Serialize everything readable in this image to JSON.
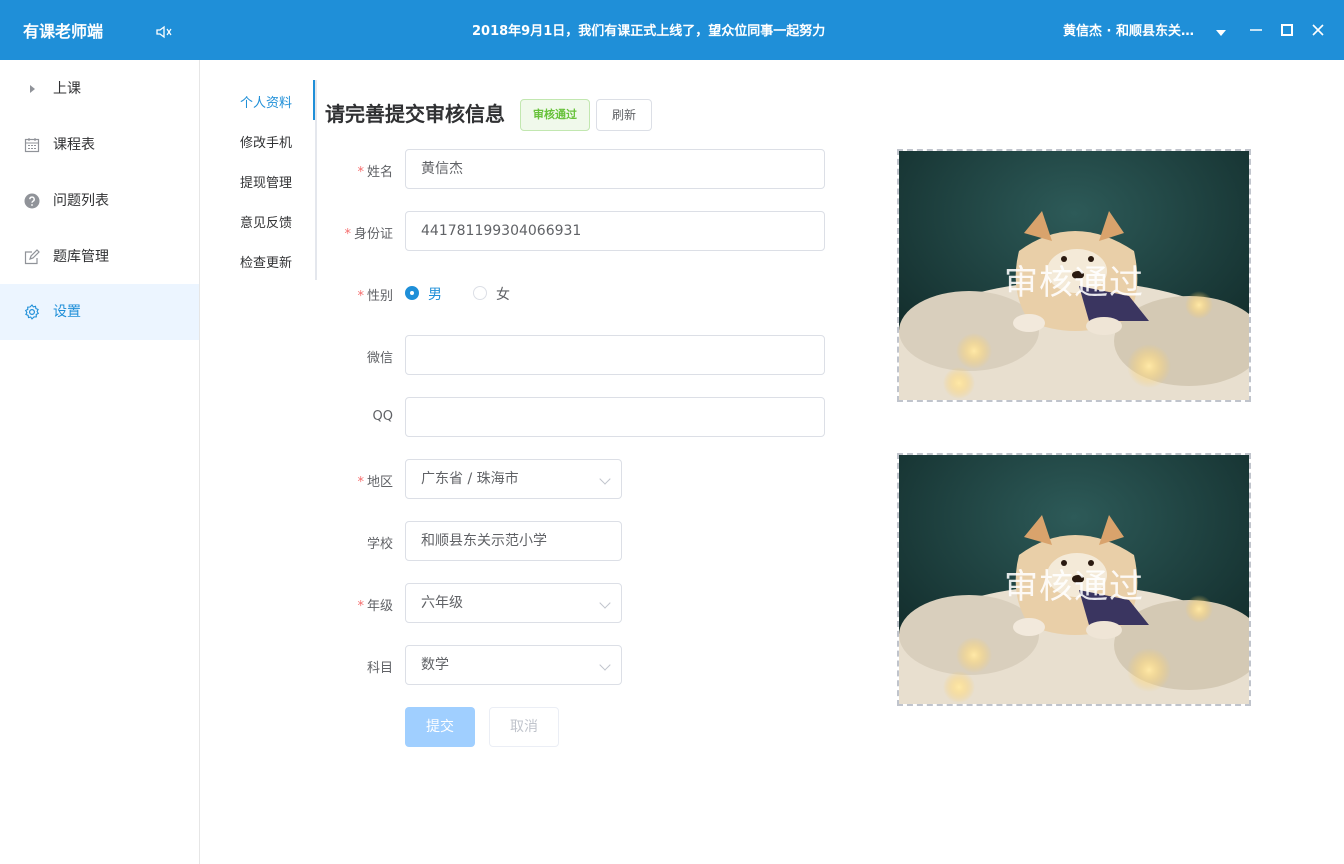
{
  "header": {
    "app_title": "有课老师端",
    "announcement": "2018年9月1日，我们有课正式上线了，望众位同事一起努力",
    "user": "黄信杰 · 和顺县东关示范小学"
  },
  "sidebar": {
    "items": [
      {
        "label": "上课",
        "icon": "play-icon"
      },
      {
        "label": "课程表",
        "icon": "calendar-icon"
      },
      {
        "label": "问题列表",
        "icon": "question-icon"
      },
      {
        "label": "题库管理",
        "icon": "edit-icon"
      },
      {
        "label": "设置",
        "icon": "gear-icon",
        "active": true
      }
    ]
  },
  "submenu": {
    "items": [
      "个人资料",
      "修改手机",
      "提现管理",
      "意见反馈",
      "检查更新"
    ],
    "active_index": 0
  },
  "form": {
    "title": "请完善提交审核信息",
    "status_tag": "审核通过",
    "refresh_label": "刷新",
    "required_mark": "*",
    "fields": {
      "name": {
        "label": "姓名",
        "value": "黄信杰"
      },
      "id_card": {
        "label": "身份证",
        "value": "441781199304066931"
      },
      "gender": {
        "label": "性别",
        "options": [
          "男",
          "女"
        ],
        "selected": "男"
      },
      "wechat": {
        "label": "微信",
        "value": ""
      },
      "qq": {
        "label": "QQ",
        "value": ""
      },
      "region": {
        "label": "地区",
        "value": "广东省 / 珠海市"
      },
      "school": {
        "label": "学校",
        "value": "和顺县东关示范小学"
      },
      "grade": {
        "label": "年级",
        "value": "六年级"
      },
      "subject": {
        "label": "科目",
        "value": "数学"
      }
    },
    "submit_label": "提交",
    "cancel_label": "取消"
  },
  "photos": {
    "watermark": "审核通过"
  },
  "colors": {
    "primary": "#1f8fd8",
    "success": "#67c23a",
    "required": "#f56c6c"
  }
}
